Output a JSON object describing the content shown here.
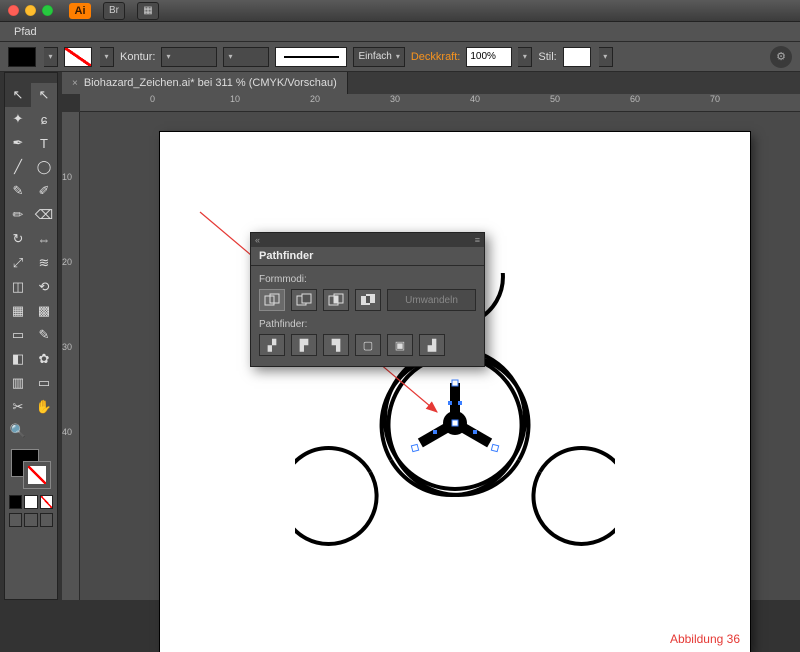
{
  "titlebar": {
    "app_badge": "Ai",
    "br_label": "Br"
  },
  "context_label": "Pfad",
  "controlbar": {
    "kontur_label": "Kontur:",
    "stroke_style": "Einfach",
    "deckkraft_label": "Deckkraft:",
    "opacity_value": "100%",
    "stil_label": "Stil:"
  },
  "doc_tab": {
    "title": "Biohazard_Zeichen.ai* bei 311 % (CMYK/Vorschau)"
  },
  "ruler": {
    "h": [
      "0",
      "10",
      "20",
      "30",
      "40",
      "50",
      "60",
      "70"
    ],
    "v": [
      "10",
      "20",
      "30",
      "40"
    ]
  },
  "pathfinder": {
    "title": "Pathfinder",
    "formmodi_label": "Formmodi:",
    "umwandeln_label": "Umwandeln",
    "pathfinder_label": "Pathfinder:"
  },
  "caption": "Abbildung 36",
  "tools": {
    "selection": "↖",
    "direct": "↖",
    "wand": "✦",
    "lasso": "ɕ",
    "pen": "✒",
    "type": "T",
    "line": "╱",
    "ellipse": "◯",
    "brush": "✎",
    "pencil": "✐",
    "blob": "✏",
    "eraser": "⌫",
    "rotate": "↻",
    "reflect": "⇔",
    "scale": "⤢",
    "warp": "≋",
    "shapeb": "◫",
    "freetr": "⟲",
    "persp": "▦",
    "mesh": "▩",
    "grad": "▭",
    "eyedrop": "✎",
    "blend": "◧",
    "symbol": "✿",
    "graph": "▥",
    "artb": "▭",
    "slice": "✂",
    "hand": "✋",
    "zoom": "🔍"
  }
}
